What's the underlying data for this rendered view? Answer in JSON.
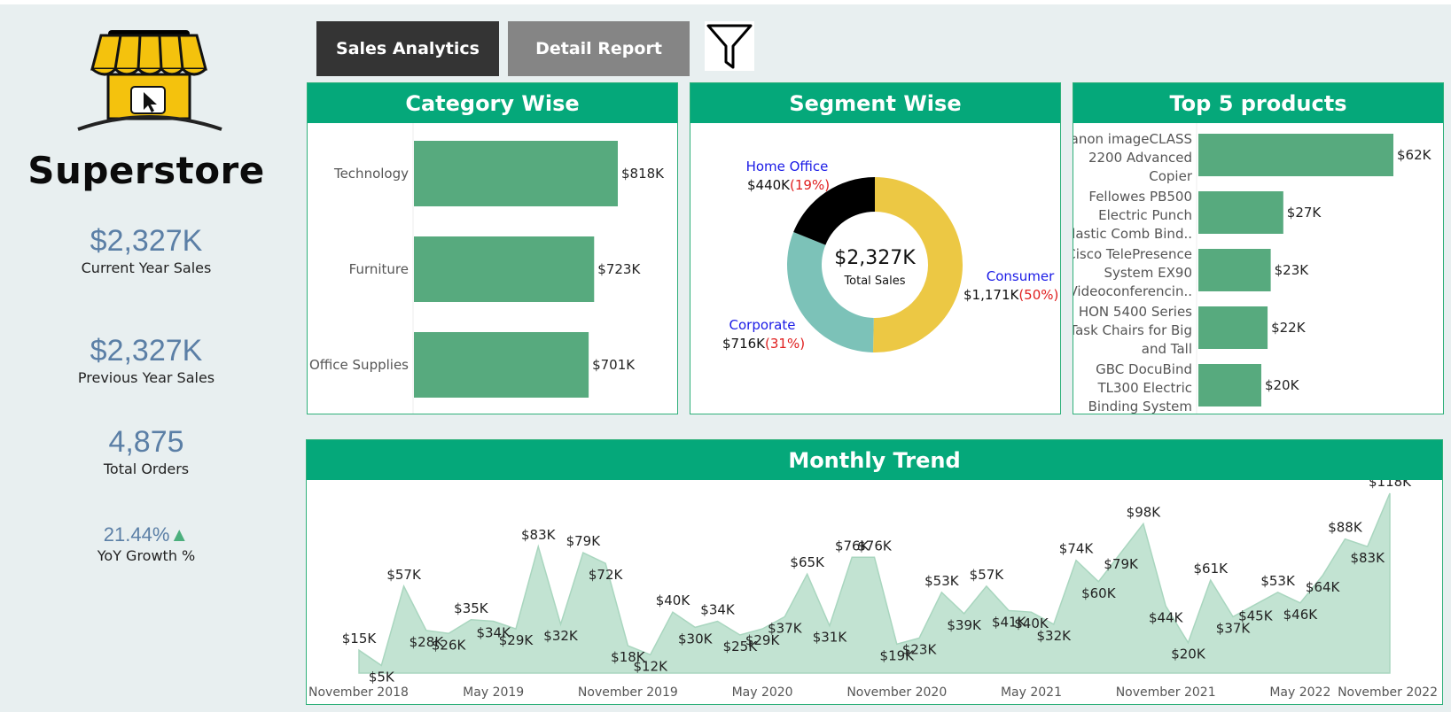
{
  "sidebar": {
    "brand": "Superstore",
    "kpis": [
      {
        "value": "$2,327K",
        "label": "Current Year Sales"
      },
      {
        "value": "$2,327K",
        "label": "Previous Year Sales"
      },
      {
        "value": "4,875",
        "label": "Total Orders"
      },
      {
        "value": "21.44%",
        "label": "YoY Growth %",
        "indicator": "up-triangle-icon"
      }
    ]
  },
  "nav": {
    "sales_analytics": "Sales Analytics",
    "detail_report": "Detail Report",
    "filter_icon": "filter-funnel-icon"
  },
  "colors": {
    "header_green": "#05a87a",
    "bar_green": "#57aa7e",
    "area_fill": "#c2e3d2",
    "donut_consumer": "#ecc844",
    "donut_corporate": "#7cc2b8",
    "donut_home_office": "#000000",
    "kpi_blue": "#5b7fa6"
  },
  "panels": {
    "category": "Category Wise",
    "segment": "Segment Wise",
    "products": "Top 5 products",
    "trend": "Monthly Trend"
  },
  "chart_data": [
    {
      "type": "bar",
      "orientation": "horizontal",
      "title": "Category Wise",
      "categories": [
        "Technology",
        "Furniture",
        "Office Supplies"
      ],
      "values": [
        818,
        723,
        701
      ],
      "labels": [
        "$818K",
        "$723K",
        "$701K"
      ],
      "unit": "$K"
    },
    {
      "type": "pie",
      "variant": "donut",
      "title": "Segment Wise",
      "center_value": "$2,327K",
      "center_label": "Total Sales",
      "slices": [
        {
          "name": "Consumer",
          "value": 1171,
          "value_label": "$1,171K",
          "pct_label": "(50%)",
          "percent": 50
        },
        {
          "name": "Corporate",
          "value": 716,
          "value_label": "$716K",
          "pct_label": "(31%)",
          "percent": 31
        },
        {
          "name": "Home Office",
          "value": 440,
          "value_label": "$440K",
          "pct_label": "(19%)",
          "percent": 19
        }
      ]
    },
    {
      "type": "bar",
      "orientation": "horizontal",
      "title": "Top 5 products",
      "categories": [
        [
          "Canon imageCLASS",
          "2200 Advanced",
          "Copier"
        ],
        [
          "Fellowes PB500",
          "Electric Punch",
          "Plastic Comb Bind.."
        ],
        [
          "Cisco TelePresence",
          "System EX90",
          "Videoconferencin.."
        ],
        [
          "HON 5400 Series",
          "Task Chairs for Big",
          "and Tall"
        ],
        [
          "GBC DocuBind",
          "TL300 Electric",
          "Binding System"
        ]
      ],
      "values": [
        62,
        27,
        23,
        22,
        20
      ],
      "labels": [
        "$62K",
        "$27K",
        "$23K",
        "$22K",
        "$20K"
      ],
      "unit": "$K"
    },
    {
      "type": "area",
      "title": "Monthly Trend",
      "x": [
        "Nov 2018",
        "Dec 2018",
        "Jan 2019",
        "Feb 2019",
        "Mar 2019",
        "Apr 2019",
        "May 2019",
        "Jun 2019",
        "Jul 2019",
        "Aug 2019",
        "Sep 2019",
        "Oct 2019",
        "Nov 2019",
        "Dec 2019",
        "Jan 2020",
        "Feb 2020",
        "Mar 2020",
        "Apr 2020",
        "May 2020",
        "Jun 2020",
        "Jul 2020",
        "Aug 2020",
        "Sep 2020",
        "Oct 2020",
        "Nov 2020",
        "Dec 2020",
        "Jan 2021",
        "Feb 2021",
        "Mar 2021",
        "Apr 2021",
        "May 2021",
        "Jun 2021",
        "Jul 2021",
        "Aug 2021",
        "Sep 2021",
        "Oct 2021",
        "Nov 2021",
        "Dec 2021",
        "Jan 2022",
        "Feb 2022",
        "Mar 2022",
        "Apr 2022",
        "May 2022",
        "Jun 2022",
        "Jul 2022",
        "Aug 2022",
        "Sep 2022",
        "Oct 2022",
        "Nov 2022"
      ],
      "values": [
        15,
        5,
        57,
        28,
        26,
        35,
        34,
        29,
        83,
        32,
        79,
        72,
        18,
        12,
        40,
        30,
        34,
        25,
        29,
        37,
        65,
        31,
        76,
        76,
        19,
        23,
        53,
        39,
        57,
        41,
        40,
        32,
        74,
        60,
        79,
        98,
        44,
        20,
        61,
        37,
        45,
        53,
        46,
        64,
        88,
        83,
        118
      ],
      "labels": [
        "$15K",
        "$5K",
        "$57K",
        "$28K",
        "$26K",
        "$35K",
        "$34K",
        "$29K",
        "$83K",
        "$32K",
        "$79K",
        "$72K",
        "$18K",
        "$12K",
        "$40K",
        "$30K",
        "$34K",
        "$25K",
        "$29K",
        "$37K",
        "$65K",
        "$31K",
        "$76K",
        "$76K",
        "$19K",
        "$23K",
        "$53K",
        "$39K",
        "$57K",
        "$41K",
        "$40K",
        "$32K",
        "$74K",
        "$60K",
        "$79K",
        "$98K",
        "$44K",
        "$20K",
        "$61K",
        "$37K",
        "$45K",
        "$53K",
        "$46K",
        "$64K",
        "$88K",
        "$83K",
        "$118K"
      ],
      "x_ticks": [
        "November 2018",
        "May 2019",
        "November 2019",
        "May 2020",
        "November 2020",
        "May 2021",
        "November 2021",
        "May 2022",
        "November 2022"
      ],
      "unit": "$K"
    }
  ]
}
